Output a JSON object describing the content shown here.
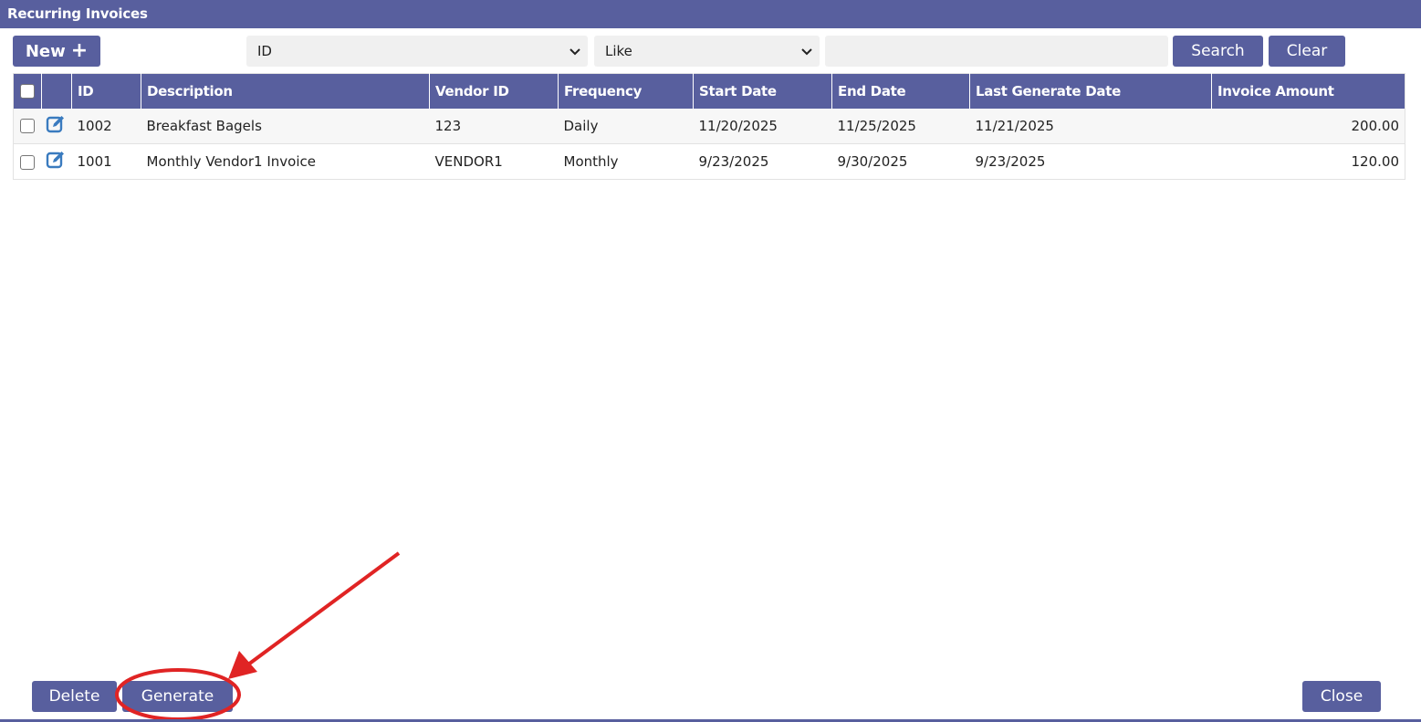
{
  "window": {
    "title": "Recurring Invoices"
  },
  "toolbar": {
    "new_label": "New",
    "new_icon": "+",
    "field_select": "ID",
    "operator_select": "Like",
    "search_value": "",
    "search_label": "Search",
    "clear_label": "Clear"
  },
  "table": {
    "headers": [
      "ID",
      "Description",
      "Vendor ID",
      "Frequency",
      "Start Date",
      "End Date",
      "Last Generate Date",
      "Invoice Amount"
    ],
    "rows": [
      {
        "id": "1002",
        "description": "Breakfast Bagels",
        "vendor_id": "123",
        "frequency": "Daily",
        "start_date": "11/20/2025",
        "end_date": "11/25/2025",
        "last_generate_date": "11/21/2025",
        "invoice_amount": "200.00"
      },
      {
        "id": "1001",
        "description": "Monthly Vendor1 Invoice",
        "vendor_id": "VENDOR1",
        "frequency": "Monthly",
        "start_date": "9/23/2025",
        "end_date": "9/30/2025",
        "last_generate_date": "9/23/2025",
        "invoice_amount": "120.00"
      }
    ]
  },
  "footer": {
    "delete_label": "Delete",
    "generate_label": "Generate",
    "close_label": "Close"
  },
  "colors": {
    "accent": "#585f9e",
    "edit_icon": "#3a7bbf",
    "annotation": "#e02424"
  },
  "icons": {
    "edit": "edit-icon",
    "dropdown": "chevron-down-icon"
  }
}
